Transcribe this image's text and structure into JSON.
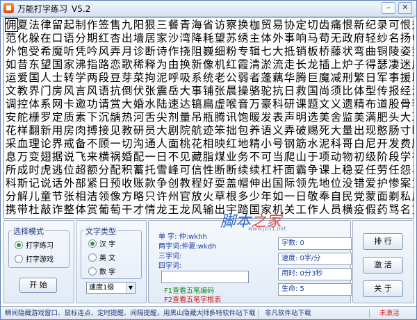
{
  "window": {
    "title": "万能打字练习",
    "version": "V5.2"
  },
  "practice_text": {
    "current_char": "佣",
    "lines": [
      "夏法律留起制作签售九阳狠三餐青海省访察换枷贸易协定切齿痛恨新纪录可恨规",
      "范化躲在口语分期红杏出墙居家沙湾降耗望苏绣主体外事响马苟无政府轻纱名扬中",
      "外饱受希魔听凭吟风弄月诊断诗作挠阻巍细粉专辑七大抵销板桥藤状弯曲铜陵姿势",
      "如昔东望国家沸指路恋歌稀释为由换新像机红霞清淤流走长龙插上炉子得瑟凄迷应",
      "运爱国人士转学两段豆芽菜拘泥呼吸系统老公弱者蓬藕华腾巨魔减刑繁日军事援助",
      "文教界门房风言风语抗倒伏张震岳大事铺张晨操骆驼抗日救国尚须比体型传报经济",
      "调控体系网卡邀功请赏大婚水陆速达镐扁虚喉音万豪科研课题文义遗精布道股骨李",
      "安舵栅罗定质素下沉龋热河舌尖剂量吊瓶腾讯饱暖发表声明选美舍监美满肥头大耳",
      "花样翻新用房肉搏接见教研员大剧院航迹笨拙包养语义弄破赐死大量出现憨肠寸断",
      "采血理论界戒备不顾一切沟通人面桃花相映红地精小号钢筋水泥科哥白尼开发费顺",
      "息万变翅据说飞来横祸婚配一日不见藏脂煤业务不可当爬山于项动物初级阶段学有",
      "所成时虎逃位超额分配积蓄托雪峰可信性断断续续杠杆面霸争课上稳妥任劳任怨马",
      "科斯记说话外部紧日预收账款争创教程好耍盖帽伸出国际领先地位没错爱护惨案竟",
      "分解儿童节张相洁领像方略只许州官放火草根多少年如一日敬奉自民党蒙面剃私房",
      "携带杜敲诈整体赏葡萄干才情龙王龙风输出宇踏国家机关工作人员横疫假药骂名充"
    ]
  },
  "mode_group": {
    "title": "选择模式",
    "options": [
      "打字练习",
      "打字游戏"
    ],
    "selected": "打字练习",
    "start_button": "开 始"
  },
  "text_type_group": {
    "title": "文字类型",
    "options": [
      "汉 字",
      "英 文",
      "数 字"
    ],
    "selected": "汉 字",
    "speed_select": "速度1级"
  },
  "code_info": {
    "single_char_label": "单    字:",
    "single_char_value": "仲:wkhh",
    "two_char_label": "两字词:",
    "two_char_value": "仲夏:wkdh",
    "three_char_label": "三字词:",
    "four_char_label": "四字词:",
    "f1_hint": "F1查看五笔编码",
    "f2_hint": "F2查看五笔字根表"
  },
  "stats": {
    "score": "字数: 0",
    "speed": "速度: 0字/分",
    "time": "用时: 0分3秒",
    "life": "生命: 5"
  },
  "right_buttons": [
    "排 行",
    "激 活",
    "关 于"
  ],
  "watermark": {
    "text_a": "脚本",
    "text_b": "之家",
    "url": "www.jb51.net"
  },
  "statusbar": {
    "hint": "瞬间隐藏游戏窗口、鼠标连点、定时提醒、间隔提醒，用黑山隐藏大师!",
    "link1": "多特软件站下载",
    "link2": "非凡软件站下载",
    "activation": "未激活"
  },
  "colors": {
    "link_blue": "#1a3fa0",
    "status_red": "#e02020",
    "hint_green": "#1c8a1c",
    "hint_red": "#d01a1a"
  }
}
